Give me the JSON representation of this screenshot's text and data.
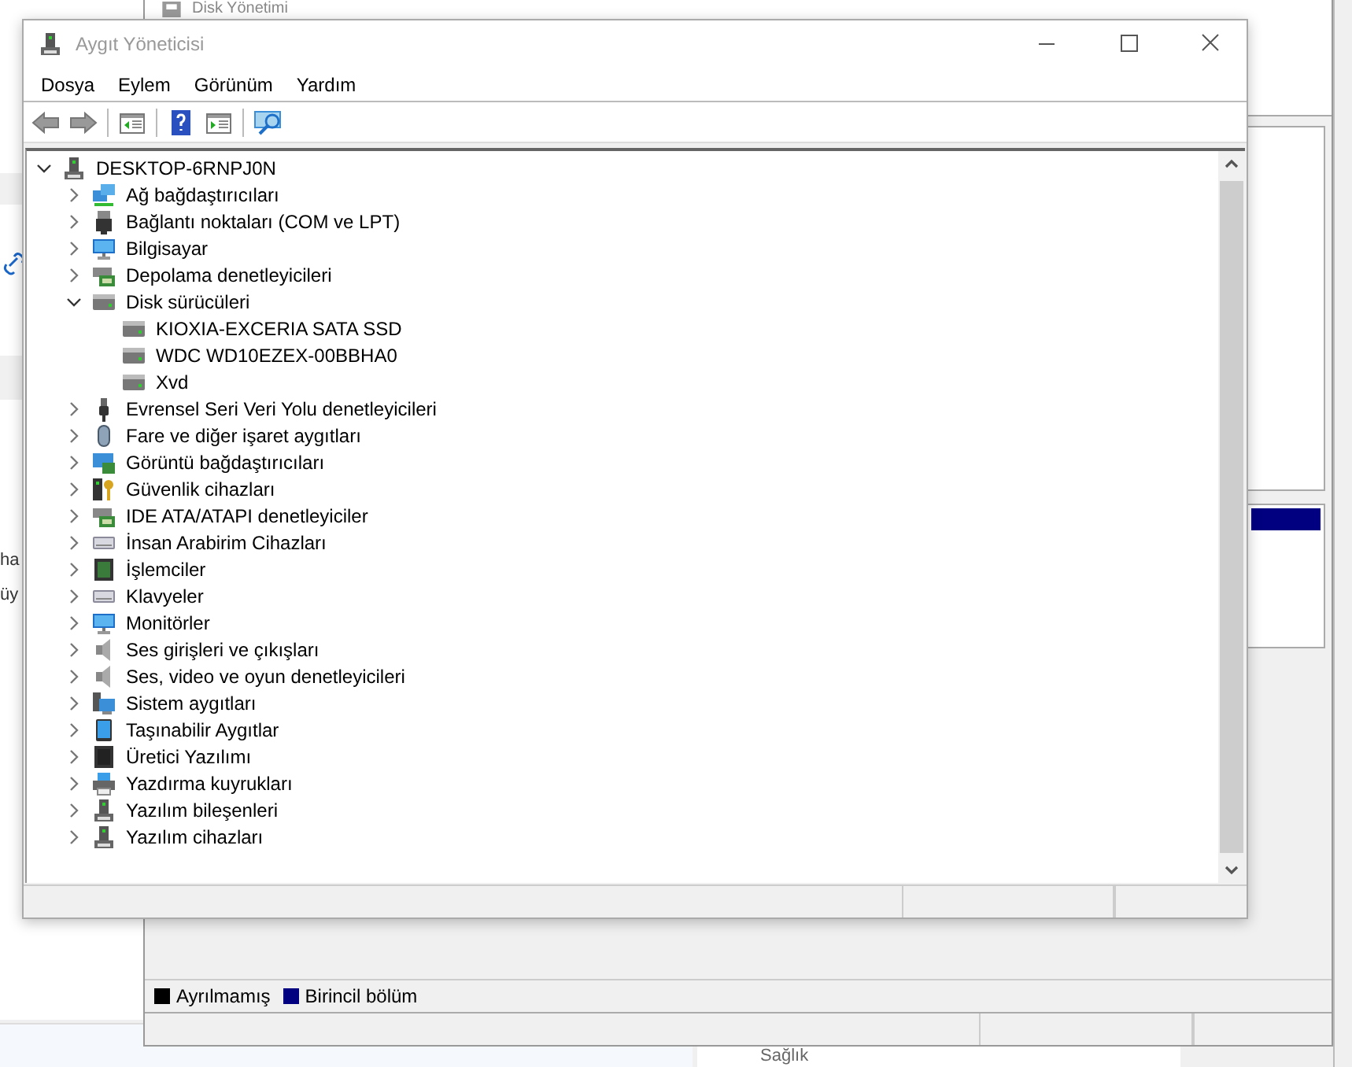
{
  "window": {
    "title": "Aygıt Yöneticisi"
  },
  "menu": [
    "Dosya",
    "Eylem",
    "Görünüm",
    "Yardım"
  ],
  "tree": {
    "label": "DESKTOP-6RNPJ0N",
    "kind": "root",
    "expanded": true,
    "children": [
      {
        "label": "Ağ bağdaştırıcıları",
        "kind": "network",
        "expanded": false
      },
      {
        "label": "Bağlantı noktaları (COM ve LPT)",
        "kind": "port",
        "expanded": false
      },
      {
        "label": "Bilgisayar",
        "kind": "computer",
        "expanded": false
      },
      {
        "label": "Depolama denetleyicileri",
        "kind": "storage",
        "expanded": false
      },
      {
        "label": "Disk sürücüleri",
        "kind": "disk",
        "expanded": true,
        "children": [
          {
            "label": "KIOXIA-EXCERIA SATA SSD",
            "kind": "disk"
          },
          {
            "label": "WDC WD10EZEX-00BBHA0",
            "kind": "disk"
          },
          {
            "label": "Xvd",
            "kind": "disk"
          }
        ]
      },
      {
        "label": "Evrensel Seri Veri Yolu denetleyicileri",
        "kind": "usb",
        "expanded": false
      },
      {
        "label": "Fare ve diğer işaret aygıtları",
        "kind": "mouse",
        "expanded": false
      },
      {
        "label": "Görüntü bağdaştırıcıları",
        "kind": "display",
        "expanded": false
      },
      {
        "label": "Güvenlik cihazları",
        "kind": "security",
        "expanded": false
      },
      {
        "label": "IDE ATA/ATAPI denetleyiciler",
        "kind": "ide",
        "expanded": false
      },
      {
        "label": "İnsan Arabirim Cihazları",
        "kind": "hid",
        "expanded": false
      },
      {
        "label": "İşlemciler",
        "kind": "cpu",
        "expanded": false
      },
      {
        "label": "Klavyeler",
        "kind": "keyboard",
        "expanded": false
      },
      {
        "label": "Monitörler",
        "kind": "monitor",
        "expanded": false
      },
      {
        "label": "Ses girişleri ve çıkışları",
        "kind": "audio",
        "expanded": false
      },
      {
        "label": "Ses, video ve oyun denetleyicileri",
        "kind": "audio",
        "expanded": false
      },
      {
        "label": "Sistem aygıtları",
        "kind": "system",
        "expanded": false
      },
      {
        "label": "Taşınabilir Aygıtlar",
        "kind": "portable",
        "expanded": false
      },
      {
        "label": "Üretici Yazılımı",
        "kind": "firmware",
        "expanded": false
      },
      {
        "label": "Yazdırma kuyrukları",
        "kind": "printer",
        "expanded": false
      },
      {
        "label": "Yazılım bileşenleri",
        "kind": "component",
        "expanded": false
      },
      {
        "label": "Yazılım cihazları",
        "kind": "software",
        "expanded": false
      }
    ]
  },
  "background": {
    "disk_window": {
      "title": "Disk Yönetimi",
      "legend": [
        {
          "label": "Ayrılmamış",
          "color": "#000000"
        },
        {
          "label": "Birincil bölüm",
          "color": "#000080"
        }
      ]
    },
    "side_window": {
      "texts": [
        "ha",
        "üy"
      ]
    },
    "bottom_panel": {
      "label": "Sağlık"
    }
  }
}
